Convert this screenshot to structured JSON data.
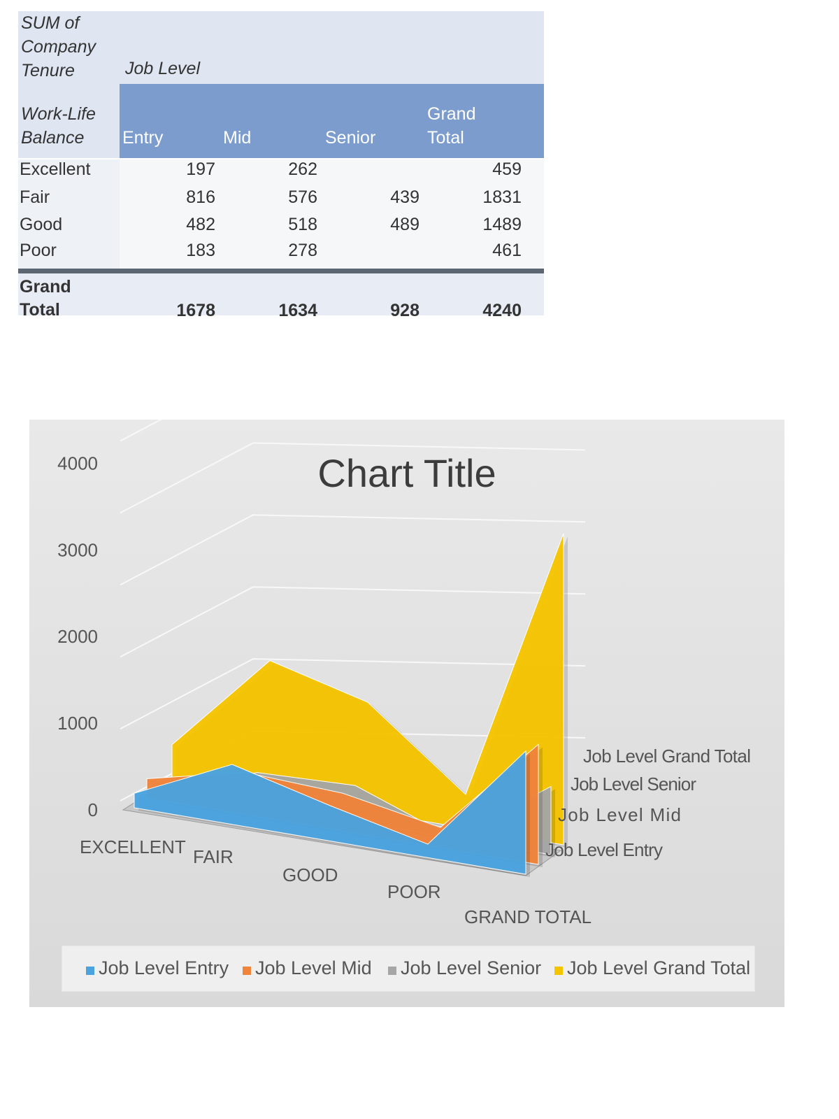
{
  "pivot": {
    "corner_label": [
      "SUM of",
      "Company",
      "Tenure"
    ],
    "column_field": "Job Level",
    "row_field": [
      "Work-Life",
      "Balance"
    ],
    "columns": [
      "Entry",
      "Mid",
      "Senior",
      "Grand",
      "Total"
    ],
    "rows": [
      {
        "label": "Excellent",
        "entry": "197",
        "mid": "262",
        "senior": "",
        "total": "459"
      },
      {
        "label": "Fair",
        "entry": "816",
        "mid": "576",
        "senior": "439",
        "total": "1831"
      },
      {
        "label": "Good",
        "entry": "482",
        "mid": "518",
        "senior": "489",
        "total": "1489"
      },
      {
        "label": "Poor",
        "entry": "183",
        "mid": "278",
        "senior": "",
        "total": "461"
      }
    ],
    "grand_total_label": [
      "Grand",
      "Total"
    ],
    "grand_total": {
      "entry": "1678",
      "mid": "1634",
      "senior": "928",
      "total": "4240"
    }
  },
  "chart_data": {
    "type": "area",
    "title": "Chart Title",
    "categories": [
      "EXCELLENT",
      "FAIR",
      "GOOD",
      "POOR",
      "GRAND TOTAL"
    ],
    "ylim": [
      0,
      5000
    ],
    "yticks": [
      0,
      1000,
      2000,
      3000,
      4000,
      5000
    ],
    "series": [
      {
        "name": "Job Level Entry",
        "values": [
          197,
          816,
          482,
          183,
          1678
        ],
        "color": "#4aa3df"
      },
      {
        "name": "Job Level Mid",
        "values": [
          262,
          576,
          518,
          278,
          1634
        ],
        "color": "#f0843b"
      },
      {
        "name": "Job Level Senior",
        "values": [
          0,
          439,
          489,
          0,
          928
        ],
        "color": "#a6a6a6"
      },
      {
        "name": "Job Level Grand Total",
        "values": [
          459,
          1831,
          1489,
          461,
          4240
        ],
        "color": "#f5c400"
      }
    ],
    "legend_position": "bottom",
    "grid": true
  }
}
